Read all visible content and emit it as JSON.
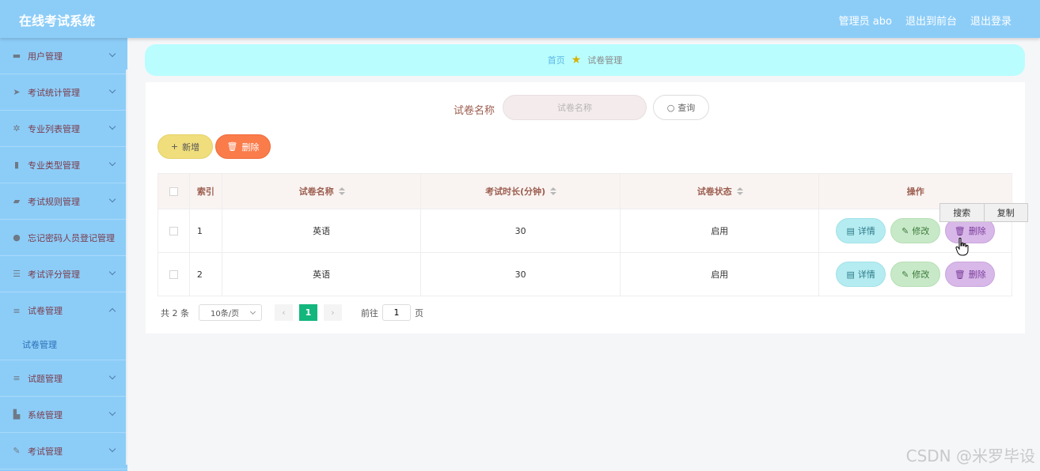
{
  "header": {
    "title": "在线考试系统",
    "admin_label": "管理员 abo",
    "front_label": "退出到前台",
    "logout_label": "退出登录"
  },
  "sidebar": {
    "items": [
      {
        "label": "用户管理",
        "icon": "user-card-icon"
      },
      {
        "label": "考试统计管理",
        "icon": "send-icon"
      },
      {
        "label": "专业列表管理",
        "icon": "compass-icon"
      },
      {
        "label": "专业类型管理",
        "icon": "clipboard-icon"
      },
      {
        "label": "考试规则管理",
        "icon": "flag-icon"
      },
      {
        "label": "忘记密码人员登记管理",
        "icon": "person-icon"
      },
      {
        "label": "考试评分管理",
        "icon": "sliders-icon"
      },
      {
        "label": "试卷管理",
        "icon": "list-icon"
      },
      {
        "label": "试题管理",
        "icon": "list-icon"
      },
      {
        "label": "系统管理",
        "icon": "bar-chart-icon"
      },
      {
        "label": "考试管理",
        "icon": "edit-icon"
      }
    ],
    "active_sub": "试卷管理"
  },
  "breadcrumb": {
    "home": "首页",
    "current": "试卷管理"
  },
  "search": {
    "label": "试卷名称",
    "placeholder": "试卷名称",
    "query_label": "查询"
  },
  "actions": {
    "add_label": "新增",
    "delete_label": "删除"
  },
  "table": {
    "headers": [
      "索引",
      "试卷名称",
      "考试时长(分钟)",
      "试卷状态",
      "操作"
    ],
    "rows": [
      {
        "index": "1",
        "name": "英语",
        "duration": "30",
        "status": "启用"
      },
      {
        "index": "2",
        "name": "英语",
        "duration": "30",
        "status": "启用"
      }
    ],
    "op_detail": "详情",
    "op_edit": "修改",
    "op_delete": "删除"
  },
  "pagination": {
    "total": "共 2 条",
    "page_size": "10条/页",
    "current_page": "1",
    "goto_label": "前往",
    "goto_value": "1",
    "page_suffix": "页"
  },
  "context_menu": {
    "search": "搜索",
    "copy": "复制"
  },
  "watermark": "CSDN @米罗毕设"
}
